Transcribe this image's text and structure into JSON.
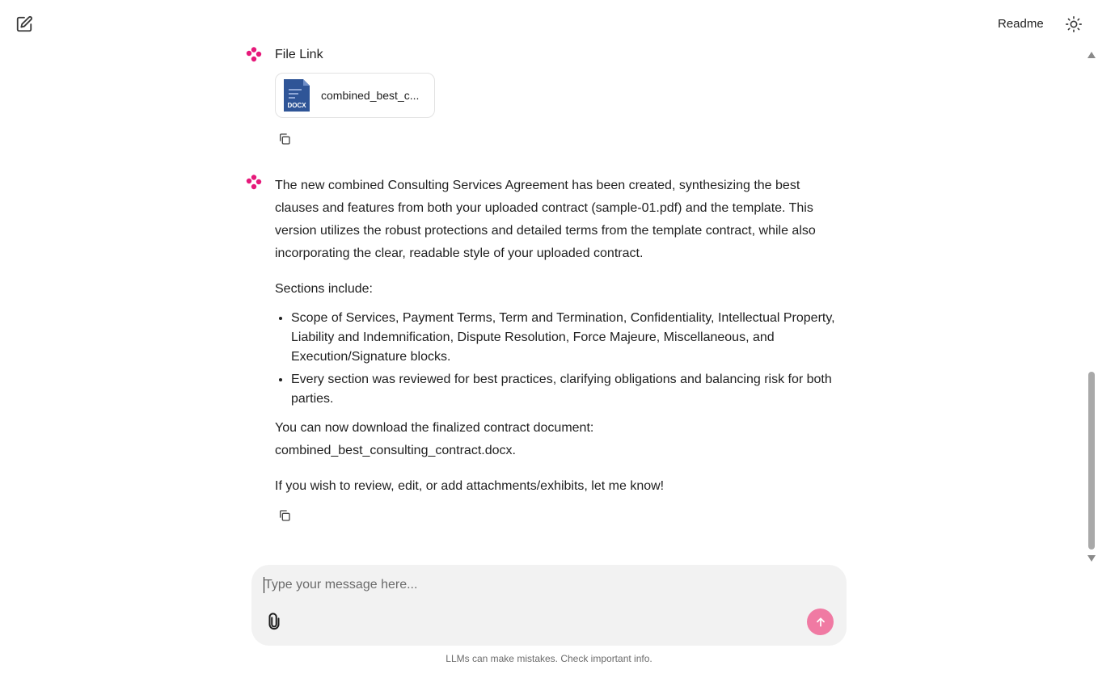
{
  "header": {
    "new_chat_icon": "edit-icon",
    "readme_label": "Readme",
    "theme_icon": "sun-icon"
  },
  "messages": [
    {
      "title": "File Link",
      "file": {
        "type_label": "DOCX",
        "name": "combined_best_c..."
      }
    },
    {
      "paragraph_1": "The new combined Consulting Services Agreement has been created, synthesizing the best clauses and features from both your uploaded contract (sample-01.pdf) and the template. This version utilizes the robust protections and detailed terms from the template contract, while also incorporating the clear, readable style of your uploaded contract.",
      "paragraph_2": "Sections include:",
      "bullets": [
        "Scope of Services, Payment Terms, Term and Termination, Confidentiality, Intellectual Property, Liability and Indemnification, Dispute Resolution, Force Majeure, Miscellaneous, and Execution/Signature blocks.",
        "Every section was reviewed for best practices, clarifying obligations and balancing risk for both parties."
      ],
      "paragraph_3_line1": "You can now download the finalized contract document:",
      "paragraph_3_line2": "combined_best_consulting_contract.docx.",
      "paragraph_4": "If you wish to review, edit, or add attachments/exhibits, let me know!"
    }
  ],
  "composer": {
    "placeholder": "Type your message here...",
    "value": ""
  },
  "disclaimer": "LLMs can make mistakes. Check important info.",
  "colors": {
    "accent_pink": "#e6197a",
    "send_button": "#f07aa3",
    "docx_blue": "#2f5597"
  }
}
